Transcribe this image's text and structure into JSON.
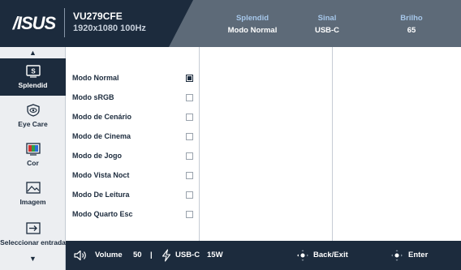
{
  "header": {
    "logo": "/ISUS",
    "model": "VU279CFE",
    "resolution": "1920x1080 100Hz",
    "status": [
      {
        "label": "Splendid",
        "value": "Modo Normal"
      },
      {
        "label": "Sinal",
        "value": "USB-C"
      },
      {
        "label": "Brilho",
        "value": "65"
      }
    ]
  },
  "sidebar": {
    "items": [
      {
        "label": "Splendid",
        "icon": "splendid-icon",
        "active": true
      },
      {
        "label": "Eye Care",
        "icon": "eye-care-icon",
        "active": false
      },
      {
        "label": "Cor",
        "icon": "color-icon",
        "active": false
      },
      {
        "label": "Imagem",
        "icon": "image-icon",
        "active": false
      },
      {
        "label": "Seleccionar entrada",
        "icon": "input-select-icon",
        "active": false
      }
    ]
  },
  "menu": {
    "options": [
      {
        "label": "Modo Normal",
        "selected": true
      },
      {
        "label": "Modo sRGB",
        "selected": false
      },
      {
        "label": "Modo de Cenário",
        "selected": false
      },
      {
        "label": "Modo de Cinema",
        "selected": false
      },
      {
        "label": "Modo de Jogo",
        "selected": false
      },
      {
        "label": "Modo Vista Noct",
        "selected": false
      },
      {
        "label": "Modo De Leitura",
        "selected": false
      },
      {
        "label": "Modo Quarto Esc",
        "selected": false
      }
    ]
  },
  "footer": {
    "volume_label": "Volume",
    "volume_value": "50",
    "separator": "|",
    "power_label": "USB-C",
    "power_value": "15W",
    "back_label": "Back/Exit",
    "enter_label": "Enter"
  },
  "colors": {
    "header_bg": "#1c2b3d",
    "header_panel": "#5d6a78",
    "accent_label": "#a6c7ea",
    "sidebar_bg": "#eceef1"
  }
}
